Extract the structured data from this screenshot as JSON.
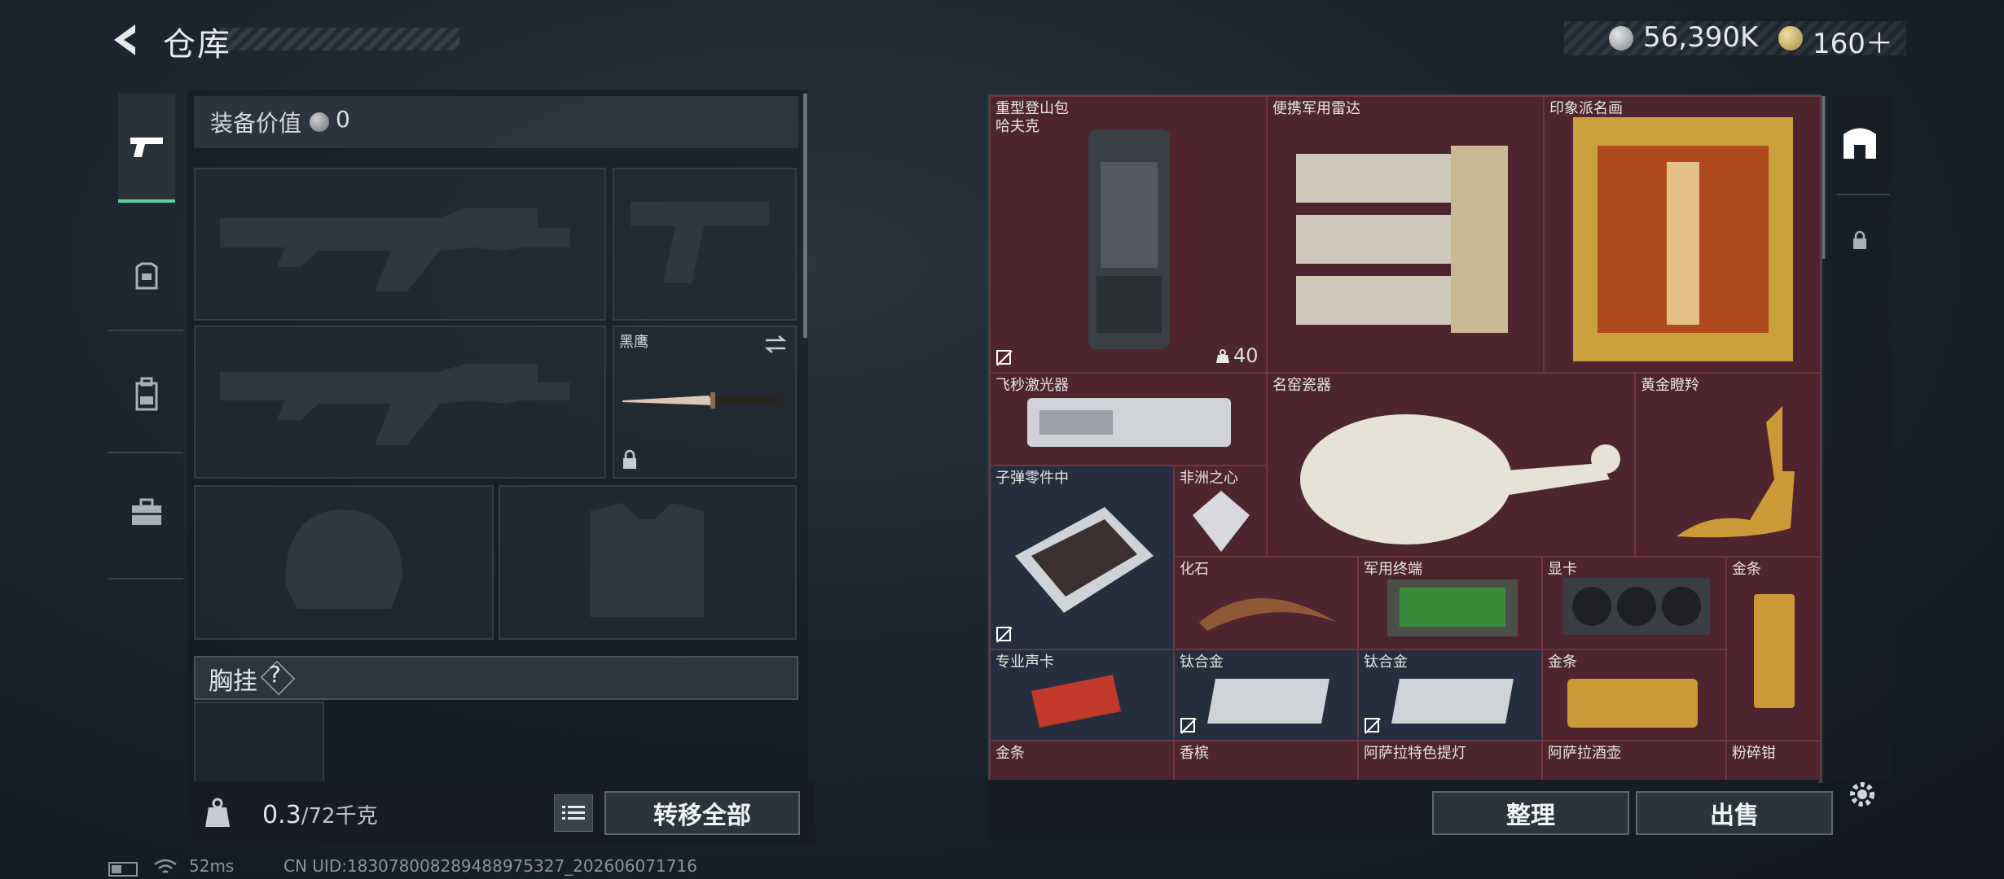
{
  "header": {
    "title": "仓库"
  },
  "currency": {
    "silver": "56,390K",
    "gold": "160＋"
  },
  "left_panel": {
    "equip_value_label": "装备价值",
    "equip_value": "0",
    "melee_name": "黑鹰",
    "chest_label": "胸挂",
    "chest_help": "?",
    "weight_current": "0.3",
    "weight_max": "/72千克",
    "transfer_all": "转移全部"
  },
  "stash": {
    "items": [
      {
        "name": "重型登山包\n哈夫克",
        "badge": "40",
        "tone": "red"
      },
      {
        "name": "便携军用雷达",
        "tone": "red"
      },
      {
        "name": "印象派名画",
        "tone": "red"
      },
      {
        "name": "飞秒激光器",
        "tone": "red"
      },
      {
        "name": "名窑瓷器",
        "tone": "red"
      },
      {
        "name": "黄金瞪羚",
        "tone": "red"
      },
      {
        "name": "子弹零件中",
        "tone": "blue"
      },
      {
        "name": "非洲之心",
        "tone": "red"
      },
      {
        "name": "化石",
        "tone": "red"
      },
      {
        "name": "军用终端",
        "tone": "red"
      },
      {
        "name": "显卡",
        "tone": "red"
      },
      {
        "name": "金条",
        "tone": "red"
      },
      {
        "name": "专业声卡",
        "tone": "blue"
      },
      {
        "name": "钛合金",
        "tone": "blue"
      },
      {
        "name": "钛合金",
        "tone": "blue"
      },
      {
        "name": "金条",
        "tone": "red"
      },
      {
        "name": "金条",
        "tone": "red"
      },
      {
        "name": "香槟",
        "tone": "red"
      },
      {
        "name": "阿萨拉特色提灯",
        "tone": "red"
      },
      {
        "name": "阿萨拉酒壶",
        "tone": "red"
      },
      {
        "name": "粉碎钳",
        "tone": "red"
      }
    ],
    "sort_label": "整理",
    "sell_label": "出售"
  },
  "status_bar": {
    "ping": "52ms",
    "uid": "CN UID:183078008289488975327_202606071716"
  },
  "colors": {
    "accent_green": "#58d39c",
    "rare_red": "#4e242e",
    "blue_cell": "#262d3f"
  },
  "icons": [
    "back-arrow-icon",
    "silver-coin-icon",
    "gold-coin-icon",
    "pistol-icon",
    "armor-icon",
    "backpack-icon",
    "toolbox-icon",
    "weight-icon",
    "list-icon",
    "safe-icon",
    "lock-icon",
    "gear-icon",
    "swap-icon",
    "battery-icon",
    "wifi-icon"
  ]
}
